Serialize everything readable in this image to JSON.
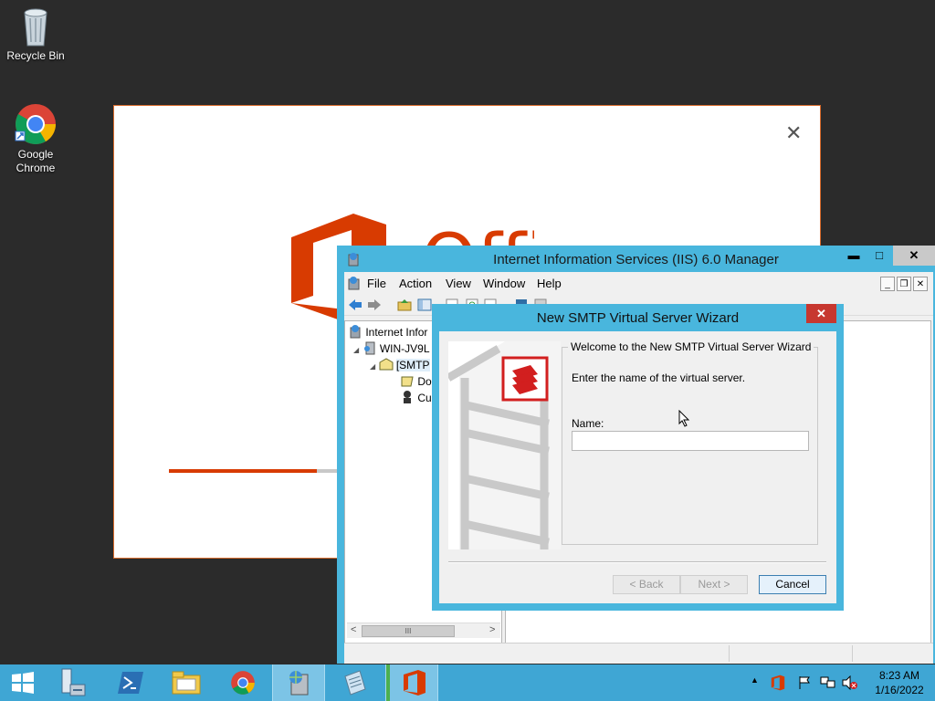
{
  "desktop": {
    "icons": [
      {
        "label_line1": "Recycle Bin",
        "label_line2": ""
      },
      {
        "label_line1": "Google",
        "label_line2": "Chrome"
      }
    ]
  },
  "office_splash": {
    "close_glyph": "✕",
    "logo_partial_text": "Offi",
    "progress_fraction": 0.85,
    "brand_color": "#d83b01"
  },
  "iis": {
    "title": "Internet Information Services (IIS) 6.0 Manager",
    "controls": {
      "minimize": "▬",
      "maximize": "□",
      "close": "✕"
    },
    "menu": [
      "File",
      "Action",
      "View",
      "Window",
      "Help"
    ],
    "mdi_controls": {
      "minimize": "_",
      "restore": "❐",
      "close": "✕"
    },
    "tree": [
      {
        "label": "Internet Infor",
        "expander": ""
      },
      {
        "label": "WIN-JV9L",
        "expander": "◢"
      },
      {
        "label": "[SMTP",
        "expander": "◢"
      },
      {
        "label": "Do",
        "expander": ""
      },
      {
        "label": "Cu",
        "expander": ""
      }
    ],
    "hscroll": {
      "left": "<",
      "thumb": "III",
      "right": ">"
    }
  },
  "wizard": {
    "title": "New SMTP Virtual Server Wizard",
    "close_glyph": "✕",
    "group_title": "Welcome to the New SMTP Virtual Server Wizard",
    "intro": "Enter the name of the virtual server.",
    "name_label": "Name:",
    "name_value": "",
    "buttons": {
      "back": "< Back",
      "next": "Next >",
      "cancel": "Cancel"
    }
  },
  "taskbar": {
    "clock_time": "8:23 AM",
    "clock_date": "1/16/2022",
    "tray_expand": "▲",
    "accent": "#3fa6d4"
  }
}
